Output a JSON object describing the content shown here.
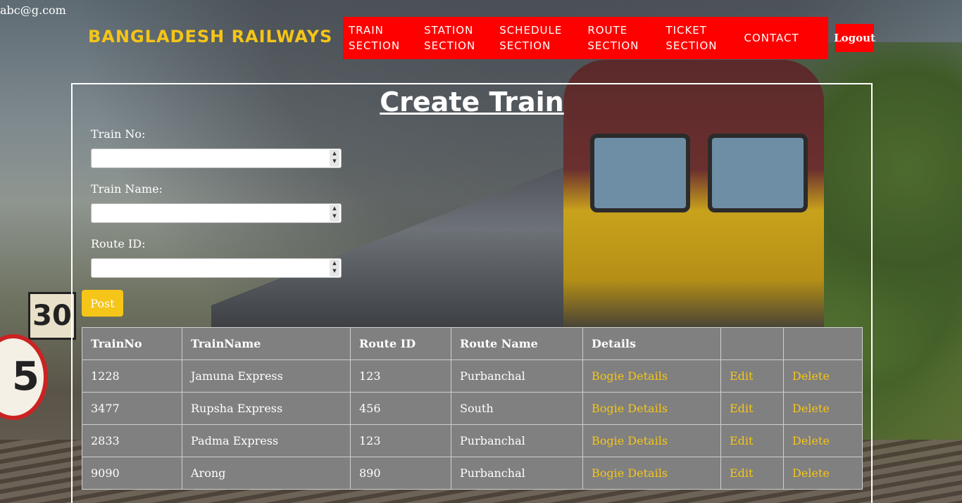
{
  "header": {
    "user_email": "abc@g.com",
    "brand": "BANGLADESH RAILWAYS",
    "nav": [
      {
        "line1": "TRAIN",
        "line2": "SECTION"
      },
      {
        "line1": "STATION",
        "line2": "SECTION"
      },
      {
        "line1": "SCHEDULE",
        "line2": "SECTION"
      },
      {
        "line1": "ROUTE",
        "line2": "SECTION"
      },
      {
        "line1": "TICKET",
        "line2": "SECTION"
      },
      {
        "line1": "CONTACT",
        "line2": ""
      }
    ],
    "logout_label": "Logout"
  },
  "form": {
    "title": "Create Train",
    "train_no_label": "Train No:",
    "train_name_label": "Train Name:",
    "route_id_label": "Route ID:",
    "train_no_value": "",
    "train_name_value": "",
    "route_id_value": "",
    "post_label": "Post"
  },
  "table": {
    "headers": [
      "TrainNo",
      "TrainName",
      "Route ID",
      "Route Name",
      "Details",
      "",
      ""
    ],
    "rows": [
      {
        "train_no": "1228",
        "train_name": "Jamuna Express",
        "route_id": "123",
        "route_name": "Purbanchal",
        "details": "Bogie Details",
        "edit": "Edit",
        "delete": "Delete"
      },
      {
        "train_no": "3477",
        "train_name": "Rupsha Express",
        "route_id": "456",
        "route_name": "South",
        "details": "Bogie Details",
        "edit": "Edit",
        "delete": "Delete"
      },
      {
        "train_no": "2833",
        "train_name": "Padma Express",
        "route_id": "123",
        "route_name": "Purbanchal",
        "details": "Bogie Details",
        "edit": "Edit",
        "delete": "Delete"
      },
      {
        "train_no": "9090",
        "train_name": "Arong",
        "route_id": "890",
        "route_name": "Purbanchal",
        "details": "Bogie Details",
        "edit": "Edit",
        "delete": "Delete"
      }
    ]
  },
  "colors": {
    "nav_bg": "#ff0000",
    "brand": "#f5c518",
    "link": "#f5c518",
    "table_bg": "#808080"
  }
}
